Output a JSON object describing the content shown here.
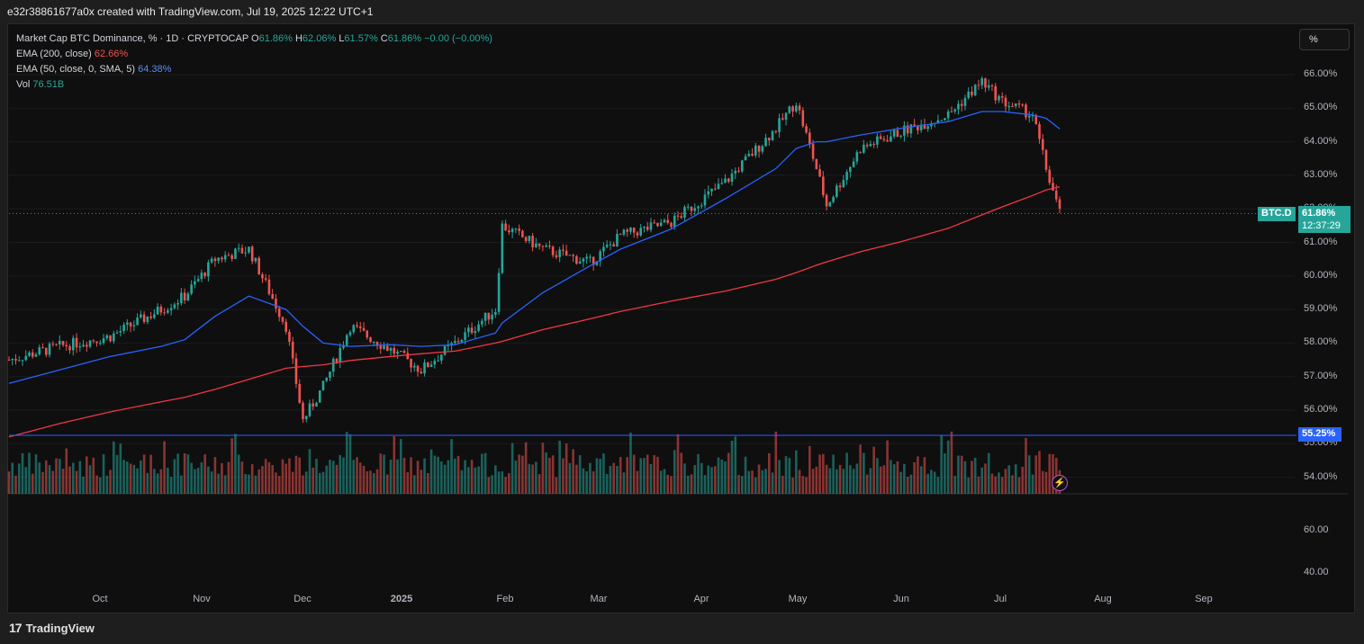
{
  "header": {
    "caption": "e32r38861677a0x created with TradingView.com, Jul 19, 2025 12:22 UTC+1"
  },
  "legend": {
    "symbol": "Market Cap BTC Dominance, % · 1D · CRYPTOCAP",
    "o_label": "O",
    "o_value": "61.86%",
    "h_label": "H",
    "h_value": "62.06%",
    "l_label": "L",
    "l_value": "61.57%",
    "c_label": "C",
    "c_value": "61.86%",
    "change": "−0.00 (−0.00%)",
    "ema200_label": "EMA (200, close)",
    "ema200_value": "62.66%",
    "ema50_label": "EMA (50, close, 0, SMA, 5)",
    "ema50_value": "64.38%",
    "vol_label": "Vol",
    "vol_value": "76.51B"
  },
  "unit_button": "%",
  "price_axis": [
    "66.00%",
    "65.00%",
    "64.00%",
    "63.00%",
    "62.00%",
    "61.00%",
    "60.00%",
    "59.00%",
    "58.00%",
    "57.00%",
    "56.00%",
    "55.00%",
    "54.00%"
  ],
  "osc_axis": [
    "60.00",
    "40.00"
  ],
  "time_axis": [
    "Oct",
    "Nov",
    "Dec",
    "2025",
    "Feb",
    "Mar",
    "Apr",
    "May",
    "Jun",
    "Jul",
    "Aug",
    "Sep"
  ],
  "tags": {
    "symbol_tag": "BTC.D",
    "last_price": "61.86%",
    "countdown": "12:37:29",
    "hline_price": "55.25%"
  },
  "footer": {
    "brand": "TradingView",
    "logo": "17"
  },
  "colors": {
    "up": "#26a69a",
    "down": "#ef5350",
    "ema50": "#2962ff",
    "ema200": "#f23645",
    "hline": "#2962ff"
  },
  "chart_data": {
    "type": "line",
    "title": "Market Cap BTC Dominance, % · 1D · CRYPTOCAP",
    "timeframe": "1D",
    "y_unit": "%",
    "ylim": [
      53.5,
      66.3
    ],
    "x": [
      "2024-09-10",
      "2024-09-25",
      "2024-10-10",
      "2024-10-25",
      "2024-11-01",
      "2024-11-10",
      "2024-11-20",
      "2024-12-01",
      "2024-12-06",
      "2024-12-12",
      "2024-12-20",
      "2025-01-01",
      "2025-01-10",
      "2025-01-20",
      "2025-02-01",
      "2025-02-03",
      "2025-02-15",
      "2025-03-01",
      "2025-03-10",
      "2025-03-25",
      "2025-04-10",
      "2025-04-25",
      "2025-05-01",
      "2025-05-07",
      "2025-05-10",
      "2025-05-20",
      "2025-06-01",
      "2025-06-15",
      "2025-06-25",
      "2025-07-01",
      "2025-07-10",
      "2025-07-14",
      "2025-07-18"
    ],
    "series": [
      {
        "name": "Market Cap BTC Dominance",
        "values": [
          57.5,
          57.9,
          58.2,
          59.0,
          59.4,
          60.5,
          60.8,
          58.5,
          55.7,
          56.7,
          58.5,
          57.8,
          57.2,
          58.0,
          59.0,
          61.5,
          60.8,
          60.4,
          61.2,
          61.6,
          62.8,
          64.4,
          65.2,
          63.2,
          62.1,
          63.8,
          64.3,
          64.8,
          65.8,
          65.2,
          64.8,
          63.2,
          61.86
        ]
      },
      {
        "name": "EMA (200, close)",
        "values": [
          55.2,
          55.6,
          55.95,
          56.25,
          56.38,
          56.62,
          56.92,
          57.25,
          57.3,
          57.35,
          57.48,
          57.6,
          57.68,
          57.76,
          58.0,
          58.05,
          58.4,
          58.72,
          58.94,
          59.25,
          59.55,
          59.9,
          60.1,
          60.32,
          60.42,
          60.72,
          61.02,
          61.42,
          61.82,
          62.06,
          62.4,
          62.56,
          62.66
        ]
      },
      {
        "name": "EMA (50, close, 0, SMA, 5)",
        "values": [
          56.8,
          57.2,
          57.6,
          57.9,
          58.1,
          58.8,
          59.4,
          59.0,
          58.5,
          58.0,
          57.9,
          57.95,
          57.9,
          57.95,
          58.3,
          58.6,
          59.5,
          60.3,
          60.8,
          61.4,
          62.3,
          63.2,
          63.8,
          64.0,
          64.0,
          64.2,
          64.4,
          64.6,
          64.9,
          64.9,
          64.8,
          64.7,
          64.38
        ]
      },
      {
        "name": "Vol",
        "values": []
      }
    ],
    "last_close": 61.86,
    "hline": 55.25,
    "volume_last": "76.51B",
    "grid": true,
    "legend_position": "top-left"
  }
}
